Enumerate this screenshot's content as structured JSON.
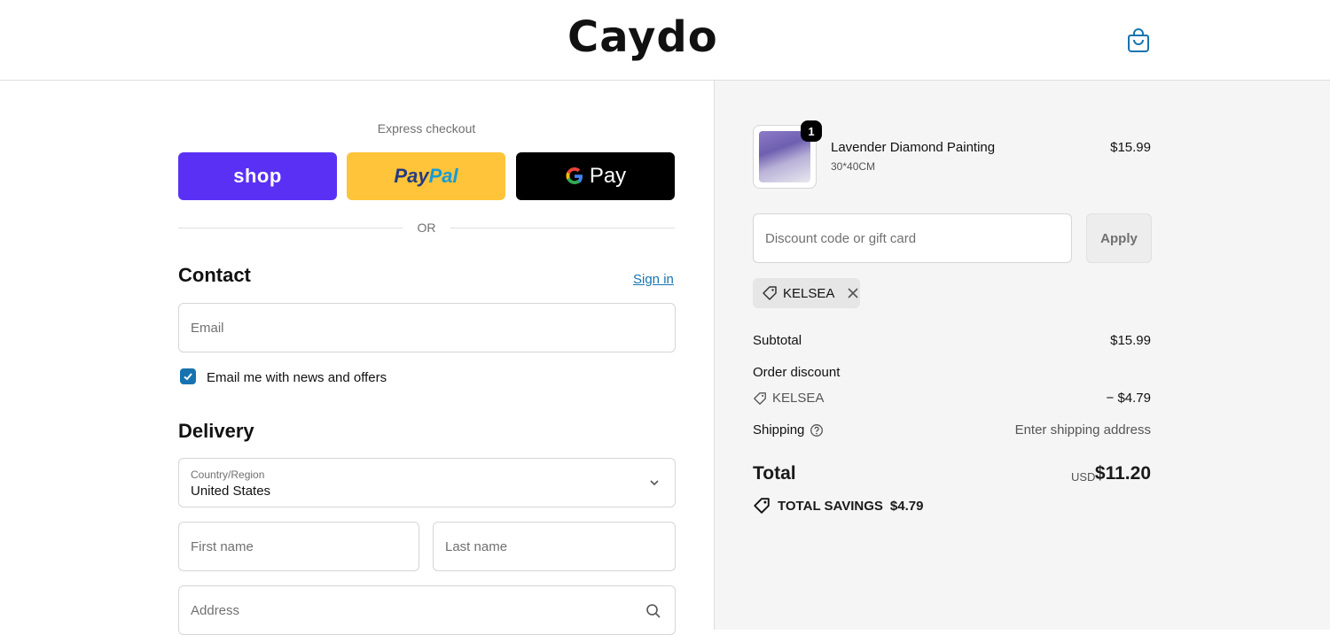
{
  "header": {
    "brand": "Caydo",
    "cart_icon": "shopping-bag-icon"
  },
  "express": {
    "label": "Express checkout",
    "shop_label": "shop",
    "paypal_part1": "Pay",
    "paypal_part2": "Pal",
    "gpay_label": "Pay",
    "or_label": "OR"
  },
  "contact": {
    "title": "Contact",
    "signin_label": "Sign in",
    "email_placeholder": "Email",
    "newsletter_label": "Email me with news and offers",
    "newsletter_checked": true
  },
  "delivery": {
    "title": "Delivery",
    "country_label": "Country/Region",
    "country_value": "United States",
    "first_name_placeholder": "First name",
    "last_name_placeholder": "Last name",
    "address_placeholder": "Address"
  },
  "order": {
    "product_name": "Lavender Diamond Painting",
    "product_variant": "30*40CM",
    "product_price": "$15.99",
    "quantity": "1",
    "discount_placeholder": "Discount code or gift card",
    "apply_label": "Apply",
    "applied_code": "KELSEA",
    "subtotal_label": "Subtotal",
    "subtotal_value": "$15.99",
    "order_discount_label": "Order discount",
    "discount_code": "KELSEA",
    "discount_value": "− $4.79",
    "shipping_label": "Shipping",
    "shipping_value": "Enter shipping address",
    "total_label": "Total",
    "total_currency": "USD",
    "total_value": "$11.20",
    "savings_label": "TOTAL SAVINGS",
    "savings_value": "$4.79"
  },
  "colors": {
    "shop": "#5a31f4",
    "paypal": "#ffc439",
    "gpay": "#000000",
    "link": "#1773b0"
  }
}
